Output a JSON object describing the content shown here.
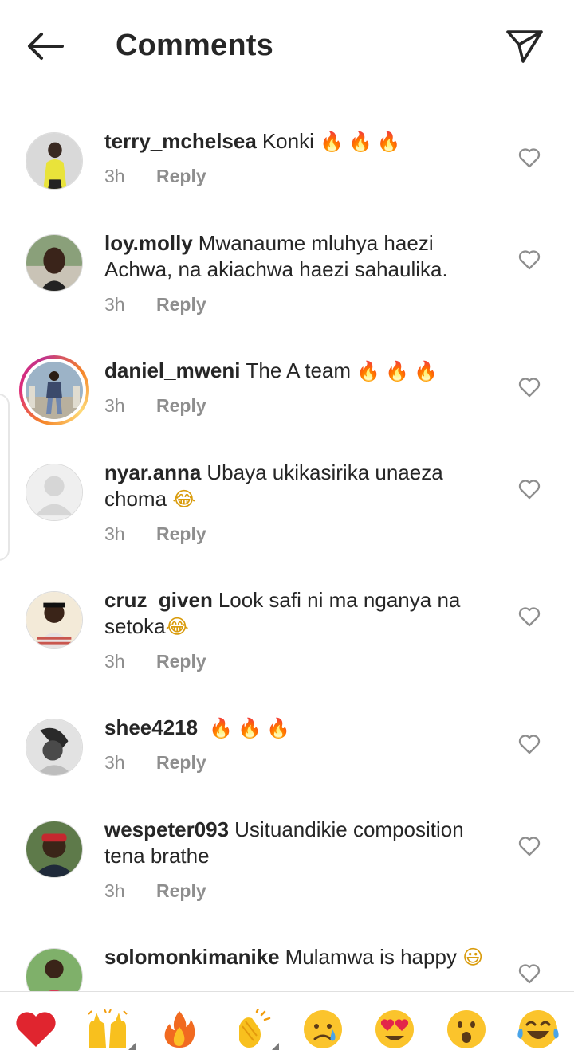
{
  "header": {
    "title": "Comments",
    "back_icon": "arrow-left-icon",
    "send_icon": "paper-plane-icon"
  },
  "comments": [
    {
      "username": "terry_mchelsea",
      "text": "Konki",
      "emoji": "🔥🔥🔥",
      "time": "3h",
      "reply": "Reply"
    },
    {
      "username": "loy.molly",
      "text": "Mwanaume mluhya haezi Achwa, na akiachwa haezi sahaulika.",
      "emoji": "",
      "time": "3h",
      "reply": "Reply"
    },
    {
      "username": "daniel_mweni",
      "text": "The A team",
      "emoji": "🔥🔥🔥",
      "time": "3h",
      "reply": "Reply"
    },
    {
      "username": "nyar.anna",
      "text": "Ubaya ukikasirika unaeza choma",
      "emoji": "😂",
      "time": "3h",
      "reply": "Reply"
    },
    {
      "username": "cruz_given",
      "text": "Look safi ni ma nganya na setoka",
      "emoji": "😂",
      "time": "3h",
      "reply": "Reply"
    },
    {
      "username": "shee4218",
      "text": "",
      "emoji": "🔥🔥🔥",
      "time": "3h",
      "reply": "Reply"
    },
    {
      "username": "wespeter093",
      "text": "Usituandikie composition tena brathe",
      "emoji": "",
      "time": "3h",
      "reply": "Reply"
    },
    {
      "username": "solomonkimanike",
      "text": "Mulamwa is happy",
      "emoji": "😃",
      "time": "",
      "reply": ""
    }
  ],
  "emoji_bar": [
    {
      "name": "red-heart-emoji",
      "glyph": "❤"
    },
    {
      "name": "raising-hands-emoji",
      "glyph": "🙌"
    },
    {
      "name": "fire-emoji",
      "glyph": "🔥"
    },
    {
      "name": "clapping-hands-emoji",
      "glyph": "👏"
    },
    {
      "name": "crying-face-emoji",
      "glyph": "😢"
    },
    {
      "name": "heart-eyes-emoji",
      "glyph": "😍"
    },
    {
      "name": "surprised-face-emoji",
      "glyph": "😮"
    },
    {
      "name": "tears-of-joy-emoji",
      "glyph": "😂"
    }
  ],
  "colors": {
    "text": "#262626",
    "secondary": "#8e8e8e",
    "story_ring_start": "#f58529",
    "story_ring_end": "#dd2a7b"
  }
}
